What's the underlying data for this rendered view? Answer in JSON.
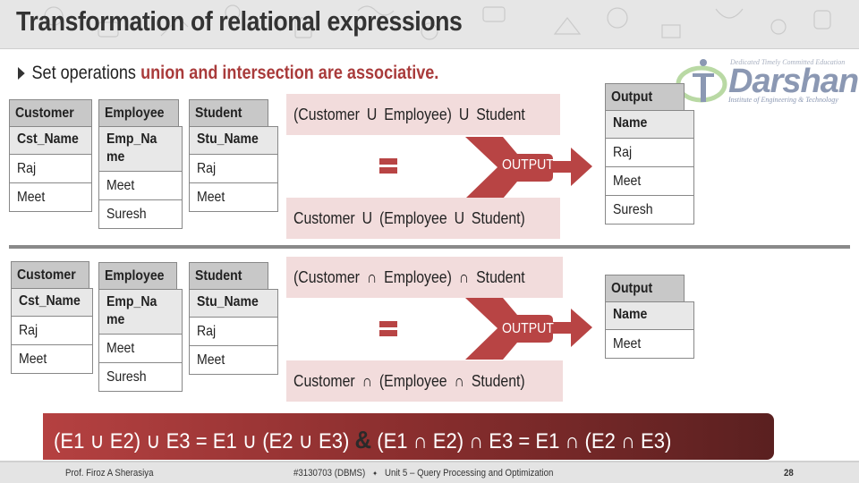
{
  "header": {
    "title": "Transformation of relational expressions"
  },
  "subtitle": {
    "prefix": "Set operations",
    "highlight": "union and intersection are associative."
  },
  "logo": {
    "tagline": "Dedicated Timely Committed Education",
    "name": "Darshan",
    "institute": "Institute of Engineering & Technology"
  },
  "union_section": {
    "tables": [
      {
        "name": "Customer",
        "column": "Cst_Name",
        "rows": [
          "Raj",
          "Meet"
        ]
      },
      {
        "name": "Employee",
        "column": "Emp_Name",
        "rows": [
          "Meet",
          "Suresh"
        ]
      },
      {
        "name": "Student",
        "column": "Stu_Name",
        "rows": [
          "Raj",
          "Meet"
        ]
      }
    ],
    "expr_top": "(Customer U Employee) U Student",
    "expr_bottom": "Customer U (Employee U Student)",
    "output_label": "OUTPUT",
    "equals_icon": "equals-icon",
    "result": {
      "name": "Output",
      "column": "Name",
      "rows": [
        "Raj",
        "Meet",
        "Suresh"
      ]
    }
  },
  "intersection_section": {
    "tables": [
      {
        "name": "Customer",
        "column": "Cst_Name",
        "rows": [
          "Raj",
          "Meet"
        ]
      },
      {
        "name": "Employee",
        "column": "Emp_Name",
        "rows": [
          "Meet",
          "Suresh"
        ]
      },
      {
        "name": "Student",
        "column": "Stu_Name",
        "rows": [
          "Raj",
          "Meet"
        ]
      }
    ],
    "expr_top": "(Customer ∩ Employee) ∩ Student",
    "expr_bottom": "Customer ∩ (Employee ∩ Student)",
    "output_label": "OUTPUT",
    "equals_icon": "equals-icon",
    "result": {
      "name": "Output",
      "column": "Name",
      "rows": [
        "Meet"
      ]
    }
  },
  "banner": {
    "union_rule": "(E1 ∪ E2) ∪ E3 =   E1 ∪ (E2 ∪ E3)",
    "amp": "&",
    "intersection_rule": "(E1 ∩ E2) ∩ E3 =   E1 ∩ (E2 ∩ E3)"
  },
  "footer": {
    "author": "Prof. Firoz A Sherasiya",
    "course": "#3130703 (DBMS)",
    "separator": "✦",
    "unit": "Unit 5 – Query Processing and Optimization",
    "page": "28"
  },
  "colors": {
    "accent": "#b84444",
    "highlight_text": "#a93b3b",
    "expr_bg": "#f2dcdc",
    "table_header": "#c8c8c8",
    "table_column": "#e8e8e8"
  }
}
